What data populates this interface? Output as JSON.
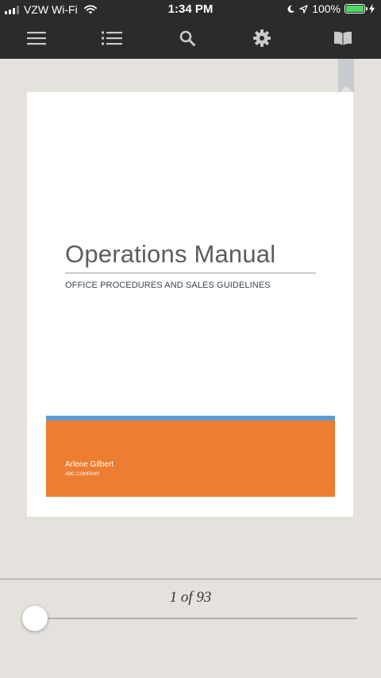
{
  "status_bar": {
    "carrier": "VZW Wi-Fi",
    "time": "1:34 PM",
    "battery": "100%",
    "icons": [
      "signal-icon",
      "wifi-icon",
      "moon-icon",
      "location-arrow-icon",
      "battery-icon",
      "charging-bolt-icon"
    ]
  },
  "toolbar": {
    "buttons": [
      "menu-icon",
      "table-of-contents-icon",
      "search-icon",
      "settings-gear-icon",
      "book-icon"
    ]
  },
  "document": {
    "title": "Operations Manual",
    "subtitle": "OFFICE PROCEDURES AND SALES GUIDELINES",
    "author": "Arlene Gilbert",
    "company": "ABC COMPANY",
    "accent_colors": {
      "blue": "#5b9bd5",
      "orange": "#ed7d31"
    }
  },
  "footer": {
    "page_indicator": "1 of 93",
    "current_page": 1,
    "total_pages": 93
  },
  "colors": {
    "toolbar_bg": "#2b2b2b",
    "reader_bg": "#e5e2dd",
    "bookmark": "#c7ccd3"
  }
}
